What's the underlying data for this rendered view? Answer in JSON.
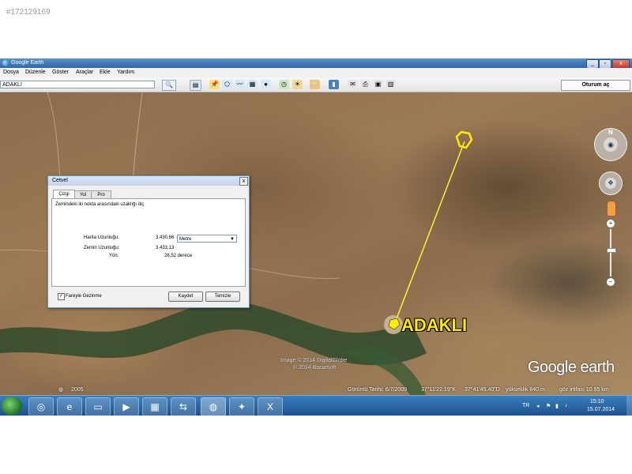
{
  "listing_id": "#172129169",
  "window": {
    "title": "Google Earth",
    "min_label": "_",
    "max_label": "▫",
    "close_label": "x"
  },
  "menu": [
    "Dosya",
    "Düzenle",
    "Göster",
    "Araçlar",
    "Ekle",
    "Yardım"
  ],
  "search": {
    "value": "ADAKLI",
    "button_icon": "🔍"
  },
  "signin_label": "Oturum aç",
  "map": {
    "place_label": "ADAKLI",
    "credits_line1": "Image © 2014 DigitalGlobe",
    "credits_line2": "© 2014 Basarsoft",
    "logo_text": "Google earth",
    "imagery_year": "2005"
  },
  "status": {
    "imagery_date": "Görüntü Tarihi: 6/7/2009",
    "lat": "37°11'22.19\"K",
    "lon": "37°41'45.40\"D",
    "elevation": "yükseklik   840 m",
    "eye_alt": "göz irtifası   10.95 km"
  },
  "ruler": {
    "title": "Cetvel",
    "close_label": "x",
    "tabs": [
      "Çizgi",
      "Yol",
      "Pro"
    ],
    "instruction": "Zemindeki iki nokta arasındaki uzaklığı ölç",
    "map_length_label": "Harita Uzunluğu:",
    "map_length_value": "3.430,66",
    "unit": "Metre",
    "ground_length_label": "Zemin Uzunluğu:",
    "ground_length_value": "3.433,13",
    "heading_label": "Yön:",
    "heading_value": "26,52 derece",
    "mouse_nav_label": "Fareyle Gezinme",
    "mouse_nav_checked": "✓",
    "save_label": "Kaydet",
    "clear_label": "Temizle"
  },
  "taskbar": {
    "language": "TR",
    "time": "15:10",
    "date": "15.07.2014"
  }
}
